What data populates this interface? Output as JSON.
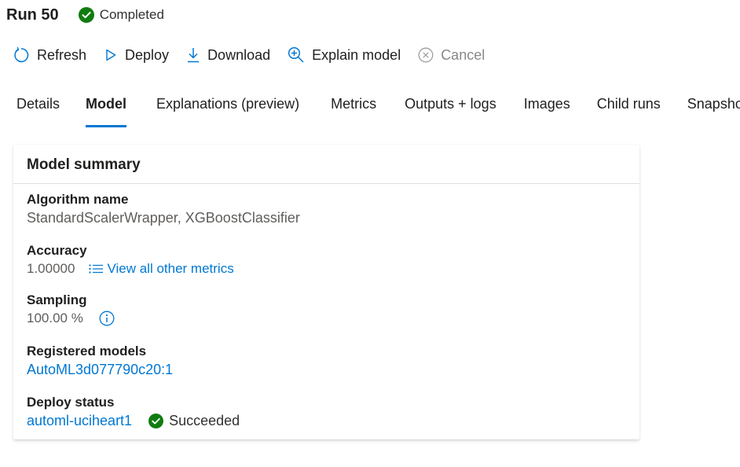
{
  "header": {
    "run_title": "Run 50",
    "status_label": "Completed",
    "status_color": "#107c10"
  },
  "toolbar": {
    "refresh": "Refresh",
    "deploy": "Deploy",
    "download": "Download",
    "explain": "Explain model",
    "cancel": "Cancel"
  },
  "tabs": [
    {
      "label": "Details"
    },
    {
      "label": "Model"
    },
    {
      "label": "Explanations (preview)"
    },
    {
      "label": "Metrics"
    },
    {
      "label": "Outputs + logs"
    },
    {
      "label": "Images"
    },
    {
      "label": "Child runs"
    },
    {
      "label": "Snapshot"
    }
  ],
  "active_tab": "Model",
  "accent_color": "#0078d4",
  "model_summary": {
    "title": "Model summary",
    "algorithm": {
      "label": "Algorithm name",
      "value": "StandardScalerWrapper, XGBoostClassifier"
    },
    "accuracy": {
      "label": "Accuracy",
      "value": "1.00000",
      "link": "View all other metrics"
    },
    "sampling": {
      "label": "Sampling",
      "value": "100.00 %"
    },
    "registered": {
      "label": "Registered models",
      "value": "AutoML3d077790c20:1"
    },
    "deploy": {
      "label": "Deploy status",
      "value": "automl-uciheart1",
      "status": "Succeeded"
    }
  }
}
